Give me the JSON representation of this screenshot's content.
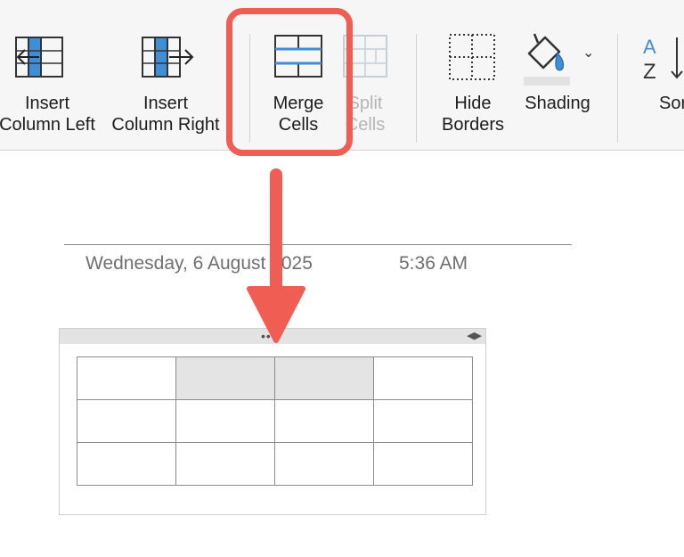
{
  "ribbon": {
    "insert_column_left": {
      "line1": "Insert",
      "line2": "Column Left",
      "icon": "insert-column-left-icon"
    },
    "insert_column_right": {
      "line1": "Insert",
      "line2": "Column Right",
      "icon": "insert-column-right-icon"
    },
    "merge_cells": {
      "line1": "Merge",
      "line2": "Cells",
      "icon": "merge-cells-icon"
    },
    "split_cells": {
      "line1": "Split",
      "line2": "Cells",
      "icon": "split-cells-icon",
      "enabled": false
    },
    "hide_borders": {
      "line1": "Hide",
      "line2": "Borders",
      "icon": "hide-borders-icon"
    },
    "shading": {
      "label": "Shading",
      "icon": "paint-bucket-icon"
    },
    "sort": {
      "label": "Sort",
      "icon": "sort-az-icon"
    }
  },
  "page": {
    "date": "Wednesday, 6 August 2025",
    "time": "5:36 AM"
  },
  "table": {
    "rows": 3,
    "cols": 4,
    "selected_cells": [
      [
        0,
        1
      ],
      [
        0,
        2
      ]
    ]
  },
  "colors": {
    "highlight": "#f05d53",
    "icon_accent": "#3e8fd8",
    "selected_cell": "#e4e4e4"
  }
}
